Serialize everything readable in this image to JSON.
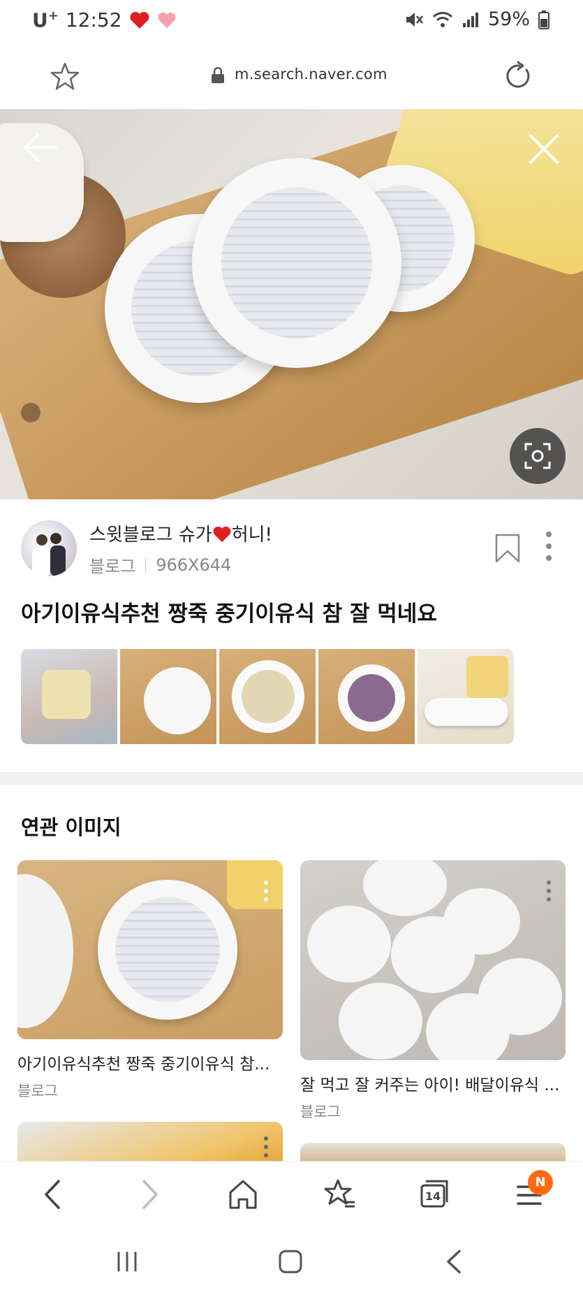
{
  "status_bar": {
    "carrier": "U",
    "carrier_sup": "+",
    "time": "12:52",
    "battery": "59%"
  },
  "browser": {
    "url": "m.search.naver.com"
  },
  "post": {
    "blogger_name_pre": "스윗블로그 슈가",
    "blogger_name_post": "허니!",
    "source": "블로그",
    "dimensions": "966X644",
    "title": "아기이유식추천 짱죽 중기이유식 참 잘 먹네요"
  },
  "related": {
    "heading": "연관 이미지",
    "cards": [
      {
        "caption": "아기이유식추천 짱죽 중기이유식 참...",
        "source": "블로그"
      },
      {
        "caption": "잘 먹고 잘 커주는 아이! 배달이유식 ...",
        "source": "블로그"
      }
    ]
  },
  "toolbar": {
    "tabs_count": "14",
    "menu_badge": "N"
  },
  "colors": {
    "badge": "#ff6a13",
    "heart": "#e02020",
    "divider": "#eef0f2"
  }
}
